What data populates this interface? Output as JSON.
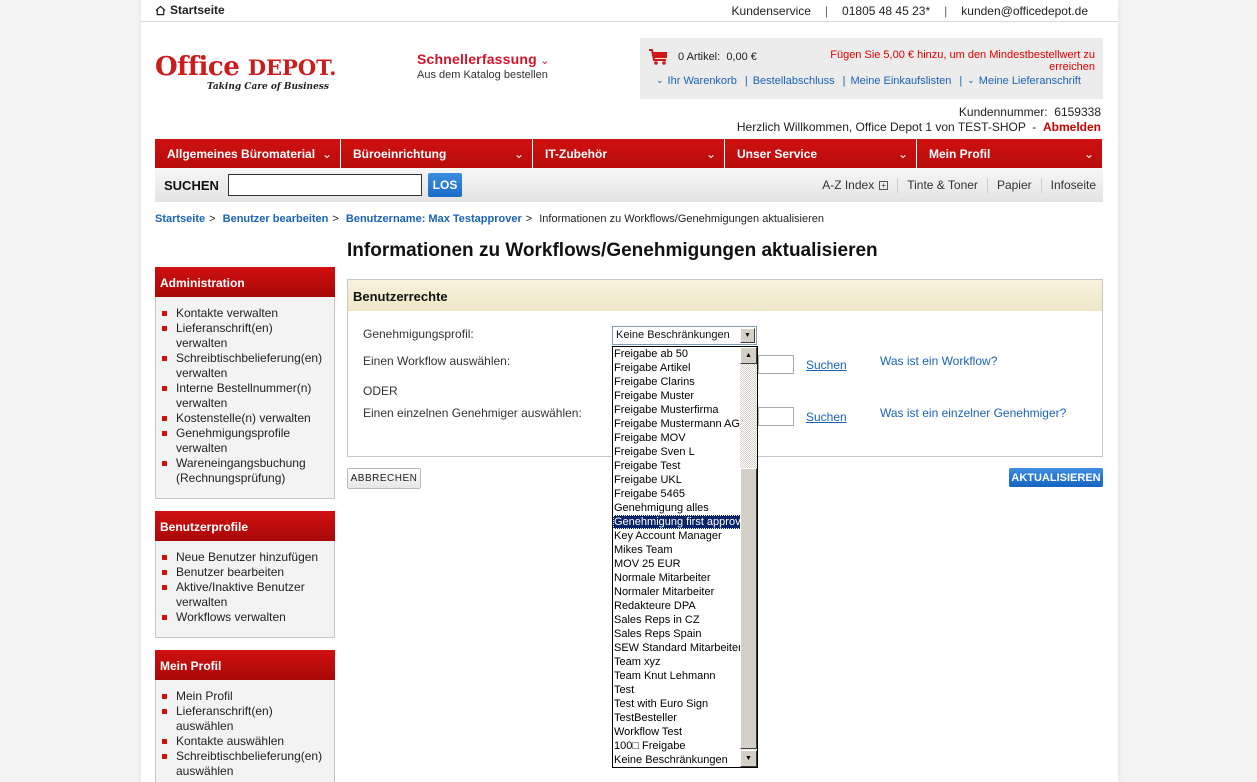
{
  "topbar": {
    "home_label": "Startseite",
    "links": [
      "Kundenservice",
      "01805 48 45 23*",
      "kunden@officedepot.de"
    ]
  },
  "logo": {
    "word1": "Office",
    "word2": "DEPOT.",
    "tagline": "Taking Care of Business"
  },
  "quick_entry": {
    "title": "Schnellerfassung",
    "subtitle": "Aus dem Katalog bestellen"
  },
  "cart": {
    "count_label": "0 Artikel:",
    "total": "0,00 €",
    "message": "Fügen Sie 5,00 € hinzu, um den Mindestbestellwert zu erreichen",
    "links": [
      "Ihr Warenkorb",
      "Bestellabschluss",
      "Meine Einkaufslisten",
      "Meine Lieferanschrift"
    ]
  },
  "account": {
    "customer_number_label": "Kundennummer:",
    "customer_number": "6159338",
    "welcome": "Herzlich Willkommen, Office Depot 1 von TEST-SHOP",
    "logout": "Abmelden"
  },
  "nav": {
    "items": [
      "Allgemeines Büromaterial",
      "Büroeinrichtung",
      "IT-Zubehör",
      "Unser Service",
      "Mein Profil"
    ]
  },
  "search": {
    "label": "SUCHEN",
    "value": "",
    "button": "LOS",
    "links": [
      "A-Z Index",
      "Tinte & Toner",
      "Papier",
      "Infoseite"
    ]
  },
  "breadcrumb": {
    "items": [
      "Startseite",
      "Benutzer bearbeiten",
      "Benutzername: Max Testapprover"
    ],
    "current": "Informationen zu Workflows/Genehmigungen aktualisieren"
  },
  "sidebar": {
    "boxes": [
      {
        "title": "Administration",
        "items": [
          "Kontakte verwalten",
          "Lieferanschrift(en) verwalten",
          "Schreibtischbelieferung(en) verwalten",
          "Interne Bestellnummer(n) verwalten",
          "Kostenstelle(n) verwalten",
          "Genehmigungsprofile verwalten",
          "Wareneingangsbuchung (Rechnungsprüfung)"
        ]
      },
      {
        "title": "Benutzerprofile",
        "items": [
          "Neue Benutzer hinzufügen",
          "Benutzer bearbeiten",
          "Aktive/Inaktive Benutzer verwalten",
          "Workflows verwalten"
        ]
      },
      {
        "title": "Mein Profil",
        "items": [
          "Mein Profil",
          "Lieferanschrift(en) auswählen",
          "Kontakte auswählen",
          "Schreibtischbelieferung(en) auswählen"
        ]
      }
    ]
  },
  "main": {
    "title": "Informationen zu Workflows/Genehmigungen aktualisieren",
    "panel_title": "Benutzerrechte",
    "profile_label": "Genehmigungsprofil:",
    "profile_value": "Keine Beschränkungen",
    "workflow_label": "Einen Workflow auswählen:",
    "or_label": "ODER",
    "approver_label": "Einen einzelnen Genehmiger auswählen:",
    "search_link": "Suchen",
    "workflow_help": "Was ist ein Workflow?",
    "approver_help": "Was ist ein einzelner Genehmiger?",
    "cancel_button": "ABBRECHEN",
    "update_button": "AKTUALISIEREN"
  },
  "dropdown": {
    "highlighted_index": 12,
    "options": [
      "Freigabe ab 50",
      "Freigabe Artikel",
      "Freigabe Clarins",
      "Freigabe Muster",
      "Freigabe Musterfirma",
      "Freigabe Mustermann AG",
      "Freigabe MOV",
      "Freigabe Sven L",
      "Freigabe Test",
      "Freigabe UKL",
      "Freigabe 5465",
      "Genehmigung alles",
      "Genehmigung first approval",
      "Key Account Manager",
      "Mikes Team",
      "MOV 25 EUR",
      "Normale Mitarbeiter",
      "Normaler Mitarbeiter",
      "Redakteure DPA",
      "Sales Reps in CZ",
      "Sales Reps Spain",
      "SEW Standard Mitarbeiter",
      "Team xyz",
      "Team Knut Lehmann",
      "Test",
      "Test with Euro Sign",
      "TestBesteller",
      "Workflow Test",
      "100□ Freigabe",
      "Keine Beschränkungen"
    ]
  }
}
